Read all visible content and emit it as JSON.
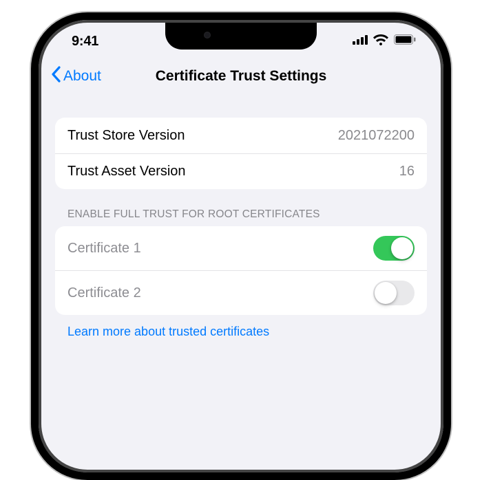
{
  "status": {
    "time": "9:41"
  },
  "nav": {
    "back_label": "About",
    "title": "Certificate Trust Settings"
  },
  "version_group": {
    "store_label": "Trust Store Version",
    "store_value": "2021072200",
    "asset_label": "Trust Asset Version",
    "asset_value": "16"
  },
  "certs": {
    "header": "ENABLE FULL TRUST FOR ROOT CERTIFICATES",
    "items": [
      {
        "label": "Certificate 1",
        "enabled": true
      },
      {
        "label": "Certificate 2",
        "enabled": false
      }
    ],
    "footer_link": "Learn more about trusted certificates"
  }
}
